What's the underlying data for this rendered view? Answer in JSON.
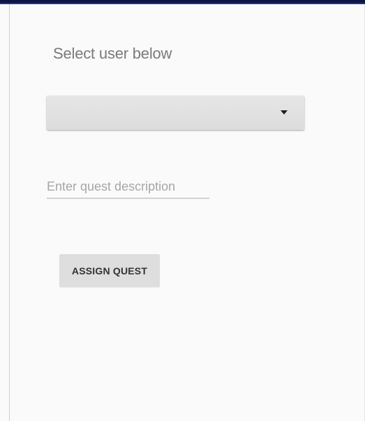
{
  "screen": {
    "heading": "Select user below"
  },
  "user_spinner": {
    "selected_value": "",
    "caret_icon": "dropdown-caret-icon"
  },
  "quest_input": {
    "value": "",
    "placeholder": "Enter quest description"
  },
  "assign_button": {
    "label": "ASSIGN QUEST"
  },
  "colors": {
    "background": "#fafafa",
    "top_border": "#0d1440",
    "spinner": "#e0e0e0",
    "button": "#dedede",
    "placeholder": "#a6a6a6",
    "heading_text": "#7a7a7a"
  }
}
